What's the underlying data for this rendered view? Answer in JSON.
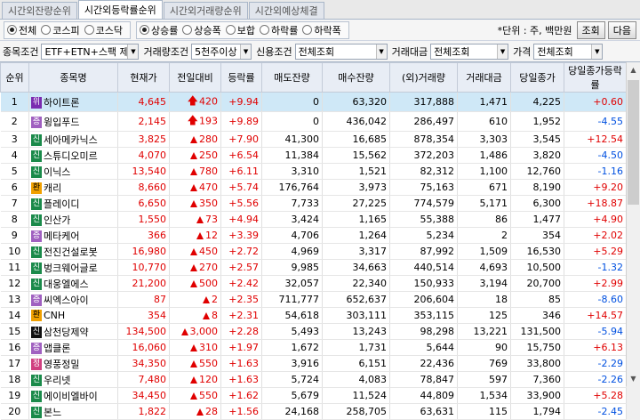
{
  "tabs": [
    "시간외잔량순위",
    "시간외등락률순위",
    "시간외거래량순위",
    "시간외예상체결"
  ],
  "active_tab": 1,
  "market_radios": [
    {
      "label": "전체",
      "on": true
    },
    {
      "label": "코스피",
      "on": false
    },
    {
      "label": "코스닥",
      "on": false
    }
  ],
  "sort_radios": [
    {
      "label": "상승률",
      "on": true
    },
    {
      "label": "상승폭",
      "on": false
    },
    {
      "label": "보합",
      "on": false
    },
    {
      "label": "하락률",
      "on": false
    },
    {
      "label": "하락폭",
      "on": false
    }
  ],
  "unit_label": "*단위 : 주, 백만원",
  "buttons": {
    "query": "조회",
    "next": "다음"
  },
  "filters": {
    "jongmok_label": "종목조건",
    "jongmok_value": "ETF+ETN+스팩 제외",
    "volume_label": "거래량조건",
    "volume_value": "5천주이상",
    "credit_label": "신용조건",
    "credit_value": "전체조회",
    "amount_label": "거래대금",
    "amount_value": "전체조회",
    "price_label": "가격",
    "price_value": "전체조회"
  },
  "headers": [
    "순위",
    "종목명",
    "현재가",
    "전일대비",
    "등락률",
    "매도잔량",
    "매수잔량",
    "(외)거래량",
    "거래대금",
    "당일종가",
    "당일종가등락률"
  ],
  "rows": [
    {
      "rank": "1",
      "badge": "위",
      "bcls": "b-ban",
      "name": "하이트론",
      "price": "4,645",
      "arrow": "up",
      "diff": "420",
      "rate": "+9.94",
      "ask": "0",
      "bid": "63,320",
      "vol": "317,888",
      "amt": "1,471",
      "close": "4,225",
      "crate": "+0.60",
      "cdir": "up",
      "selected": true
    },
    {
      "rank": "2",
      "badge": "증",
      "bcls": "b-jeung",
      "name": "윙입푸드",
      "price": "2,145",
      "arrow": "up",
      "diff": "193",
      "rate": "+9.89",
      "ask": "0",
      "bid": "436,042",
      "vol": "286,497",
      "amt": "610",
      "close": "1,952",
      "crate": "-4.55",
      "cdir": "down"
    },
    {
      "rank": "3",
      "badge": "신",
      "bcls": "b-sin",
      "name": "세아메카닉스",
      "price": "3,825",
      "arrow": "tri",
      "diff": "280",
      "rate": "+7.90",
      "ask": "41,300",
      "bid": "16,685",
      "vol": "878,354",
      "amt": "3,303",
      "close": "3,545",
      "crate": "+12.54",
      "cdir": "up"
    },
    {
      "rank": "4",
      "badge": "신",
      "bcls": "b-sin",
      "name": "스튜디오미르",
      "price": "4,070",
      "arrow": "tri",
      "diff": "250",
      "rate": "+6.54",
      "ask": "11,384",
      "bid": "15,562",
      "vol": "372,203",
      "amt": "1,486",
      "close": "3,820",
      "crate": "-4.50",
      "cdir": "down"
    },
    {
      "rank": "5",
      "badge": "신",
      "bcls": "b-sin",
      "name": "이닉스",
      "price": "13,540",
      "arrow": "tri",
      "diff": "780",
      "rate": "+6.11",
      "ask": "3,310",
      "bid": "1,521",
      "vol": "82,312",
      "amt": "1,100",
      "close": "12,760",
      "crate": "-1.16",
      "cdir": "down"
    },
    {
      "rank": "6",
      "badge": "환",
      "bcls": "b-hwan",
      "name": "캐리",
      "price": "8,660",
      "arrow": "tri",
      "diff": "470",
      "rate": "+5.74",
      "ask": "176,764",
      "bid": "3,973",
      "vol": "75,163",
      "amt": "671",
      "close": "8,190",
      "crate": "+9.20",
      "cdir": "up"
    },
    {
      "rank": "7",
      "badge": "신",
      "bcls": "b-sin",
      "name": "플레이디",
      "price": "6,650",
      "arrow": "tri",
      "diff": "350",
      "rate": "+5.56",
      "ask": "7,733",
      "bid": "27,225",
      "vol": "774,579",
      "amt": "5,171",
      "close": "6,300",
      "crate": "+18.87",
      "cdir": "up"
    },
    {
      "rank": "8",
      "badge": "신",
      "bcls": "b-sin",
      "name": "인산가",
      "price": "1,550",
      "arrow": "tri",
      "diff": "73",
      "rate": "+4.94",
      "ask": "3,424",
      "bid": "1,165",
      "vol": "55,388",
      "amt": "86",
      "close": "1,477",
      "crate": "+4.90",
      "cdir": "up"
    },
    {
      "rank": "9",
      "badge": "증",
      "bcls": "b-jeung",
      "name": "메타케어",
      "price": "366",
      "arrow": "tri",
      "diff": "12",
      "rate": "+3.39",
      "ask": "4,706",
      "bid": "1,264",
      "vol": "5,234",
      "amt": "2",
      "close": "354",
      "crate": "+2.02",
      "cdir": "up"
    },
    {
      "rank": "10",
      "badge": "신",
      "bcls": "b-sin",
      "name": "전진건설로봇",
      "price": "16,980",
      "arrow": "tri",
      "diff": "450",
      "rate": "+2.72",
      "ask": "4,969",
      "bid": "3,317",
      "vol": "87,992",
      "amt": "1,509",
      "close": "16,530",
      "crate": "+5.29",
      "cdir": "up"
    },
    {
      "rank": "11",
      "badge": "신",
      "bcls": "b-sin",
      "name": "벙크웨어글로",
      "price": "10,770",
      "arrow": "tri",
      "diff": "270",
      "rate": "+2.57",
      "ask": "9,985",
      "bid": "34,663",
      "vol": "440,514",
      "amt": "4,693",
      "close": "10,500",
      "crate": "-1.32",
      "cdir": "down"
    },
    {
      "rank": "12",
      "badge": "신",
      "bcls": "b-sin",
      "name": "대웅엘에스",
      "price": "21,200",
      "arrow": "tri",
      "diff": "500",
      "rate": "+2.42",
      "ask": "32,057",
      "bid": "22,340",
      "vol": "150,933",
      "amt": "3,194",
      "close": "20,700",
      "crate": "+2.99",
      "cdir": "up"
    },
    {
      "rank": "13",
      "badge": "증",
      "bcls": "b-jeung",
      "name": "씨엑스아이",
      "price": "87",
      "arrow": "tri",
      "diff": "2",
      "rate": "+2.35",
      "ask": "711,777",
      "bid": "652,637",
      "vol": "206,604",
      "amt": "18",
      "close": "85",
      "crate": "-8.60",
      "cdir": "down"
    },
    {
      "rank": "14",
      "badge": "환",
      "bcls": "b-hwan",
      "name": "CNH",
      "price": "354",
      "arrow": "tri",
      "diff": "8",
      "rate": "+2.31",
      "ask": "54,618",
      "bid": "303,111",
      "vol": "353,115",
      "amt": "125",
      "close": "346",
      "crate": "+14.57",
      "cdir": "up"
    },
    {
      "rank": "15",
      "badge": "신",
      "bcls": "b-sinblk",
      "name": "삼천당제약",
      "price": "134,500",
      "arrow": "tri",
      "diff": "3,000",
      "rate": "+2.28",
      "ask": "5,493",
      "bid": "13,243",
      "vol": "98,298",
      "amt": "13,221",
      "close": "131,500",
      "crate": "-5.94",
      "cdir": "down"
    },
    {
      "rank": "16",
      "badge": "증",
      "bcls": "b-jeung",
      "name": "앱클론",
      "price": "16,060",
      "arrow": "tri",
      "diff": "310",
      "rate": "+1.97",
      "ask": "1,672",
      "bid": "1,731",
      "vol": "5,644",
      "amt": "90",
      "close": "15,750",
      "crate": "+6.13",
      "cdir": "up"
    },
    {
      "rank": "17",
      "badge": "정",
      "bcls": "b-jung",
      "name": "영풍정밀",
      "price": "34,350",
      "arrow": "tri",
      "diff": "550",
      "rate": "+1.63",
      "ask": "3,916",
      "bid": "6,151",
      "vol": "22,436",
      "amt": "769",
      "close": "33,800",
      "crate": "-2.29",
      "cdir": "down"
    },
    {
      "rank": "18",
      "badge": "신",
      "bcls": "b-sin",
      "name": "우리넷",
      "price": "7,480",
      "arrow": "tri",
      "diff": "120",
      "rate": "+1.63",
      "ask": "5,724",
      "bid": "4,083",
      "vol": "78,847",
      "amt": "597",
      "close": "7,360",
      "crate": "-2.26",
      "cdir": "down"
    },
    {
      "rank": "19",
      "badge": "신",
      "bcls": "b-sin",
      "name": "에이비엘바이",
      "price": "34,450",
      "arrow": "tri",
      "diff": "550",
      "rate": "+1.62",
      "ask": "5,679",
      "bid": "11,524",
      "vol": "44,809",
      "amt": "1,534",
      "close": "33,900",
      "crate": "+5.28",
      "cdir": "up"
    },
    {
      "rank": "20",
      "badge": "신",
      "bcls": "b-sin",
      "name": "본느",
      "price": "1,822",
      "arrow": "tri",
      "diff": "28",
      "rate": "+1.56",
      "ask": "24,168",
      "bid": "258,705",
      "vol": "63,631",
      "amt": "115",
      "close": "1,794",
      "crate": "-2.45",
      "cdir": "down"
    }
  ]
}
